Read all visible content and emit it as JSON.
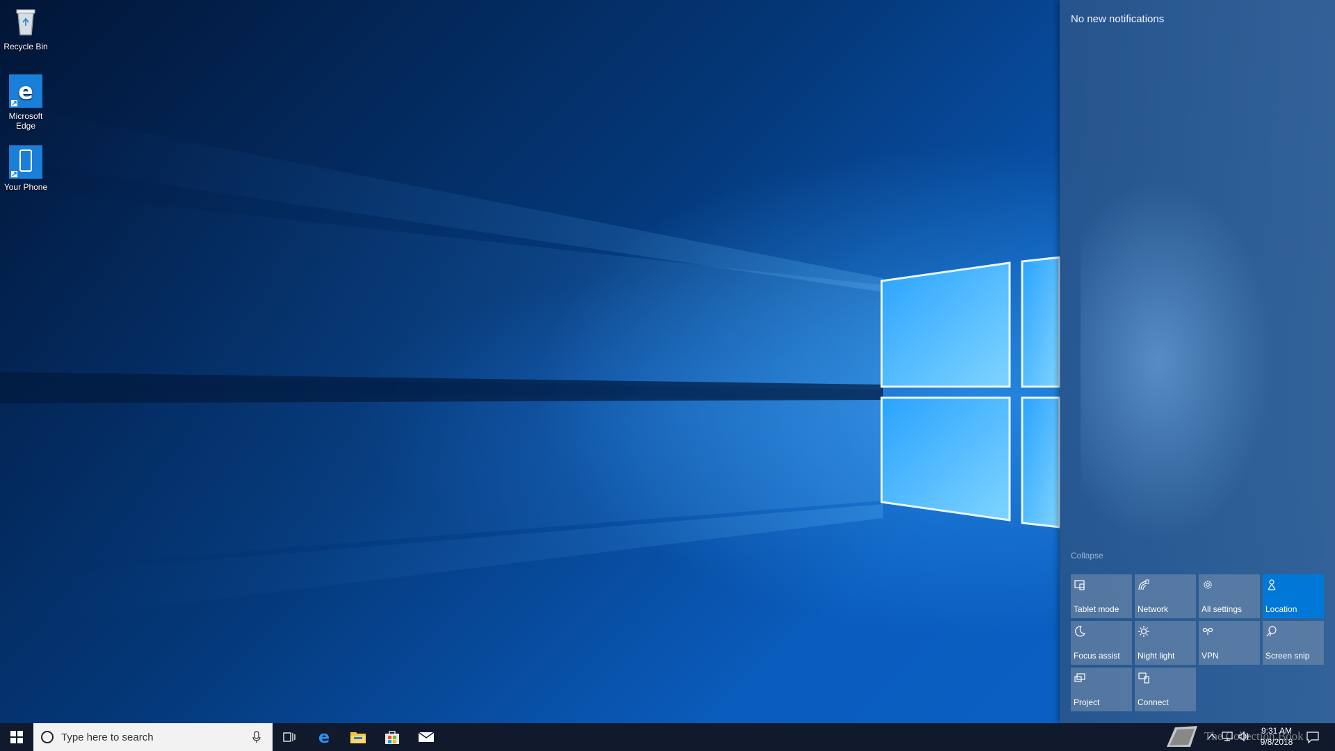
{
  "desktop": {
    "icons": [
      {
        "label": "Recycle Bin",
        "icon": "recycle-bin-icon"
      },
      {
        "label": "Microsoft Edge",
        "icon": "edge-icon"
      },
      {
        "label": "Your Phone",
        "icon": "phone-icon"
      }
    ]
  },
  "action_center": {
    "notifications_text": "No new notifications",
    "collapse_label": "Collapse",
    "tiles": [
      {
        "label": "Tablet mode",
        "icon": "tablet-mode-icon",
        "active": false
      },
      {
        "label": "Network",
        "icon": "network-icon",
        "active": false
      },
      {
        "label": "All settings",
        "icon": "gear-icon",
        "active": false
      },
      {
        "label": "Location",
        "icon": "location-icon",
        "active": true
      },
      {
        "label": "Focus assist",
        "icon": "moon-icon",
        "active": false
      },
      {
        "label": "Night light",
        "icon": "sun-icon",
        "active": false
      },
      {
        "label": "VPN",
        "icon": "vpn-icon",
        "active": false
      },
      {
        "label": "Screen snip",
        "icon": "snip-icon",
        "active": false
      },
      {
        "label": "Project",
        "icon": "project-icon",
        "active": false
      },
      {
        "label": "Connect",
        "icon": "connect-icon",
        "active": false
      }
    ],
    "active_color": "#0078d7"
  },
  "taskbar": {
    "search_placeholder": "Type here to search",
    "apps": [
      "task-view-icon",
      "edge-icon",
      "file-explorer-icon",
      "store-icon",
      "mail-icon"
    ],
    "clock": {
      "time": "9:31 AM",
      "date": "9/8/2018"
    },
    "watermark": "The Collection Book"
  }
}
